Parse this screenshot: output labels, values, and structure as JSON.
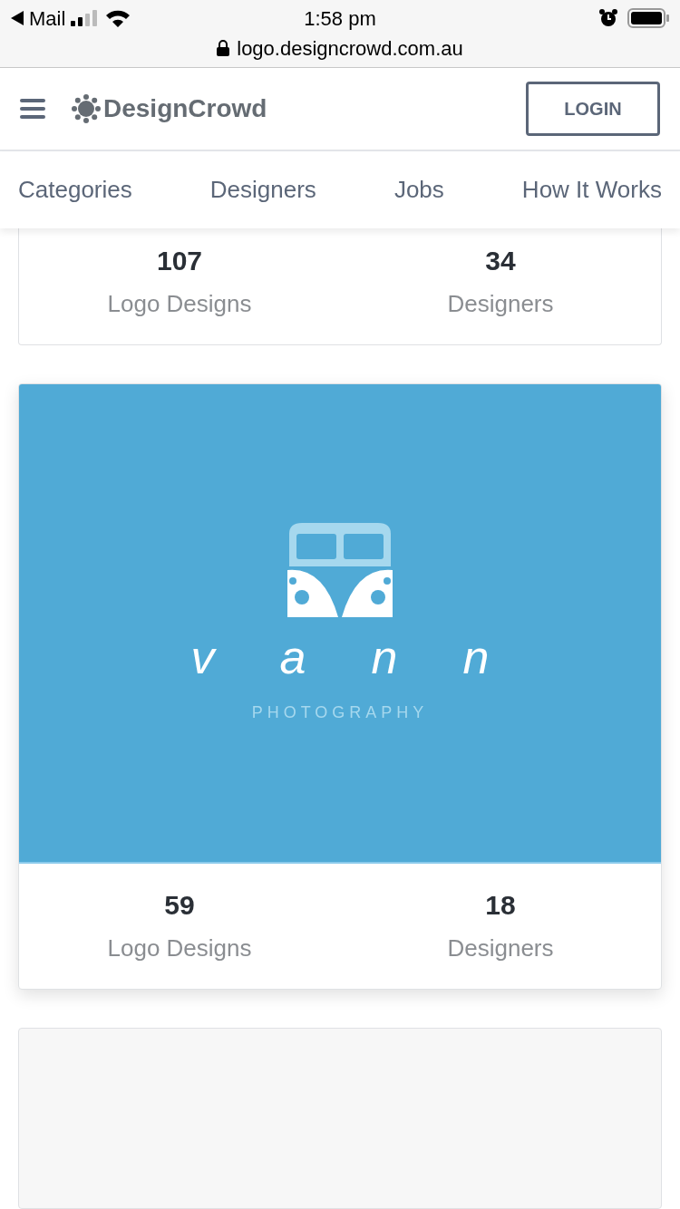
{
  "status_bar": {
    "back_app": "Mail",
    "time": "1:58 pm",
    "url": "logo.designcrowd.com.au"
  },
  "header": {
    "brand": "DesignCrowd",
    "login": "LOGIN"
  },
  "nav": [
    "Categories",
    "Designers",
    "Jobs",
    "How It Works"
  ],
  "cards": [
    {
      "kind": "stats",
      "stats": [
        {
          "value": "107",
          "label": "Logo Designs"
        },
        {
          "value": "34",
          "label": "Designers"
        }
      ]
    },
    {
      "kind": "logo",
      "logo": {
        "name": "vann",
        "tagline": "PHOTOGRAPHY"
      },
      "stats": [
        {
          "value": "59",
          "label": "Logo Designs"
        },
        {
          "value": "18",
          "label": "Designers"
        }
      ]
    },
    {
      "kind": "blank"
    }
  ]
}
